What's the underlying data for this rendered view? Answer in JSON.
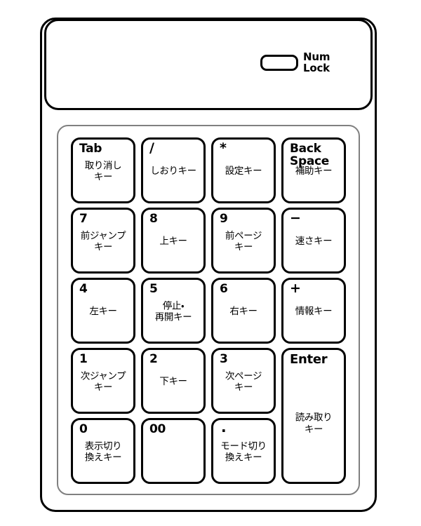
{
  "device": {
    "type": "numeric-keypad",
    "indicator": {
      "led_name": "num-lock-led",
      "label": "Num\nLock"
    }
  },
  "keys": [
    {
      "id": "tab",
      "main": "Tab",
      "sub": "取り消し\nキー",
      "style": "text",
      "span": 1
    },
    {
      "id": "slash",
      "main": "/",
      "sub": "しおりキー",
      "style": "sym",
      "span": 1
    },
    {
      "id": "asterisk",
      "main": "*",
      "sub": "設定キー",
      "style": "sym",
      "span": 1
    },
    {
      "id": "backspace",
      "main": "Back\nSpace",
      "sub": "補助キー",
      "style": "text",
      "span": 1
    },
    {
      "id": "7",
      "main": "7",
      "sub": "前ジャンプ\nキー",
      "style": "text",
      "span": 1
    },
    {
      "id": "8",
      "main": "8",
      "sub": "上キー",
      "style": "text",
      "span": 1
    },
    {
      "id": "9",
      "main": "9",
      "sub": "前ページ\nキー",
      "style": "text",
      "span": 1
    },
    {
      "id": "minus",
      "main": "−",
      "sub": "速さキー",
      "style": "sym",
      "span": 1
    },
    {
      "id": "4",
      "main": "4",
      "sub": "左キー",
      "style": "text",
      "span": 1
    },
    {
      "id": "5",
      "main": "5",
      "sub": "停止・\n再開キー",
      "style": "text",
      "span": 1
    },
    {
      "id": "6",
      "main": "6",
      "sub": "右キー",
      "style": "text",
      "span": 1
    },
    {
      "id": "plus",
      "main": "+",
      "sub": "情報キー",
      "style": "sym",
      "span": 1
    },
    {
      "id": "1",
      "main": "1",
      "sub": "次ジャンプ\nキー",
      "style": "text",
      "span": 1
    },
    {
      "id": "2",
      "main": "2",
      "sub": "下キー",
      "style": "text",
      "span": 1
    },
    {
      "id": "3",
      "main": "3",
      "sub": "次ページ\nキー",
      "style": "text",
      "span": 1
    },
    {
      "id": "enter",
      "main": "Enter",
      "sub": "読み取り\nキー",
      "style": "text",
      "span": 2
    },
    {
      "id": "0",
      "main": "0",
      "sub": "表示切り\n換えキー",
      "style": "text",
      "span": 1
    },
    {
      "id": "00",
      "main": "00",
      "sub": "",
      "style": "text",
      "span": 1
    },
    {
      "id": "period",
      "main": ".",
      "sub": "モード切り\n換えキー",
      "style": "dot",
      "span": 1
    }
  ],
  "colors": {
    "outline": "#000000",
    "frame": "#808080",
    "background": "#ffffff"
  }
}
